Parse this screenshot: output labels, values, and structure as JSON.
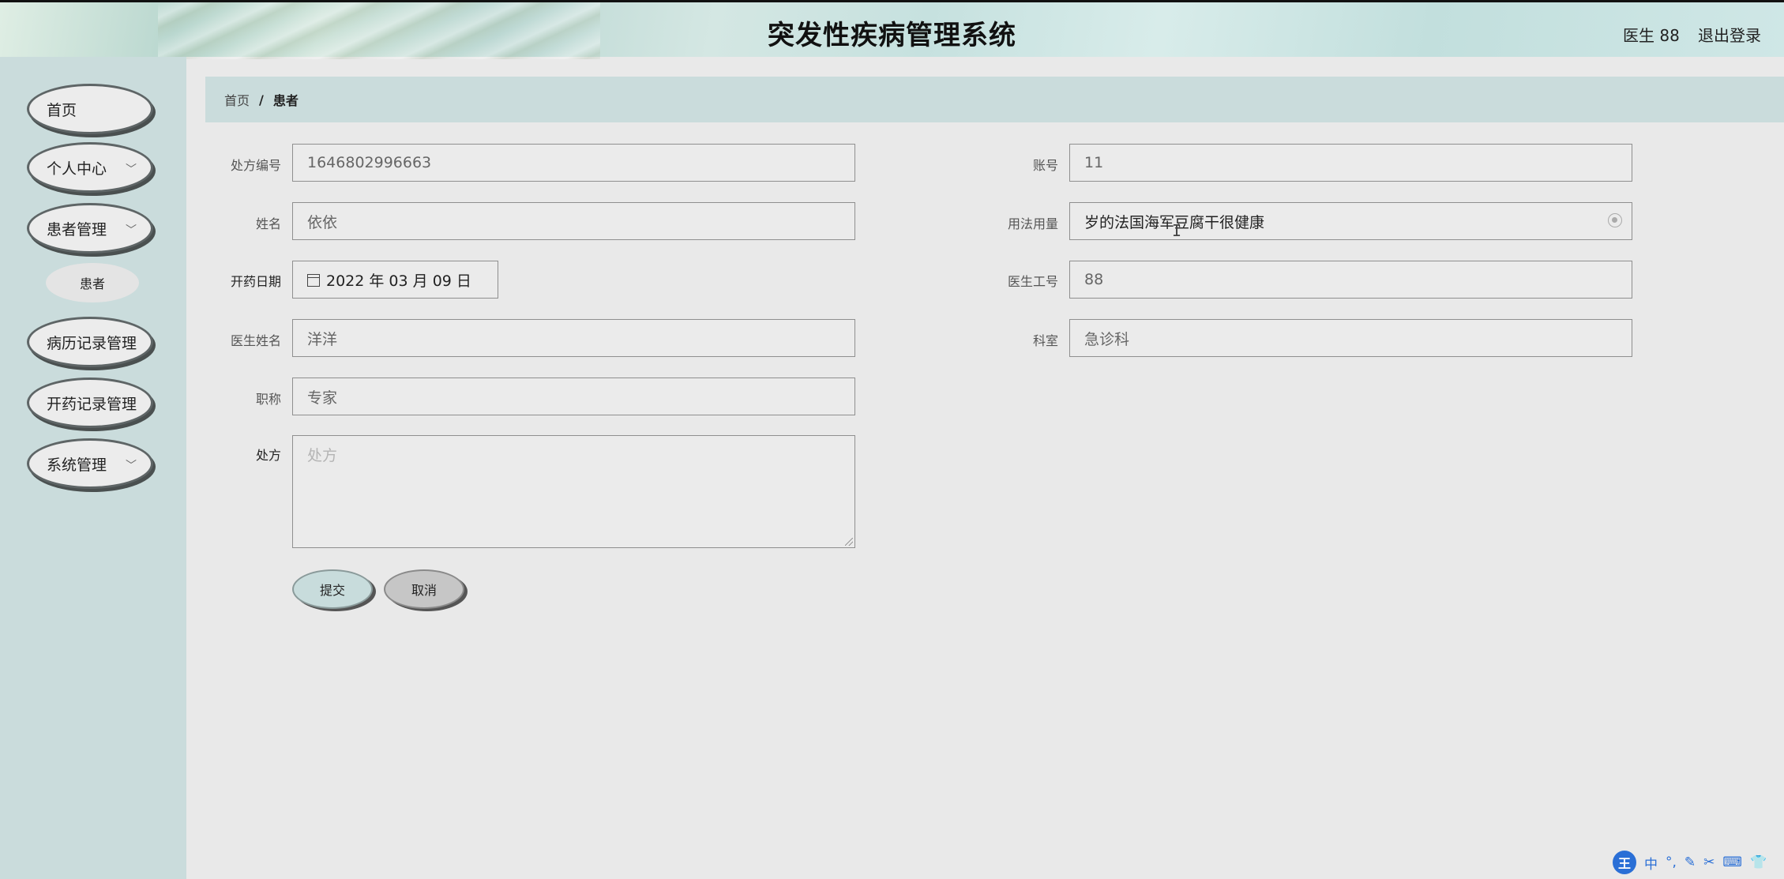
{
  "header": {
    "title": "突发性疾病管理系统",
    "user": "医生 88",
    "logout": "退出登录"
  },
  "sidebar": {
    "items": [
      {
        "label": "首页",
        "expandable": false
      },
      {
        "label": "个人中心",
        "expandable": true
      },
      {
        "label": "患者管理",
        "expandable": true
      },
      {
        "label": "病历记录管理",
        "expandable": false
      },
      {
        "label": "开药记录管理",
        "expandable": false
      },
      {
        "label": "系统管理",
        "expandable": true
      }
    ],
    "sub_item": "患者",
    "chevron": "﹀"
  },
  "breadcrumb": {
    "home": "首页",
    "separator": "/",
    "current": "患者"
  },
  "form": {
    "prescription_no": {
      "label": "处方编号",
      "value": "1646802996663"
    },
    "name": {
      "label": "姓名",
      "value": "依依"
    },
    "date": {
      "label": "开药日期",
      "value": "2022 年 03 月 09 日"
    },
    "doctor_name": {
      "label": "医生姓名",
      "value": "洋洋"
    },
    "title": {
      "label": "职称",
      "value": "专家"
    },
    "prescription": {
      "label": "处方",
      "placeholder": "处方"
    },
    "account": {
      "label": "账号",
      "value": "11"
    },
    "usage": {
      "label": "用法用量",
      "value": "岁的法国海军豆腐干很健康"
    },
    "doctor_id": {
      "label": "医生工号",
      "value": "88"
    },
    "department": {
      "label": "科室",
      "value": "急诊科"
    }
  },
  "buttons": {
    "submit": "提交",
    "cancel": "取消"
  },
  "ime": {
    "logo": "王",
    "mode": "中"
  }
}
